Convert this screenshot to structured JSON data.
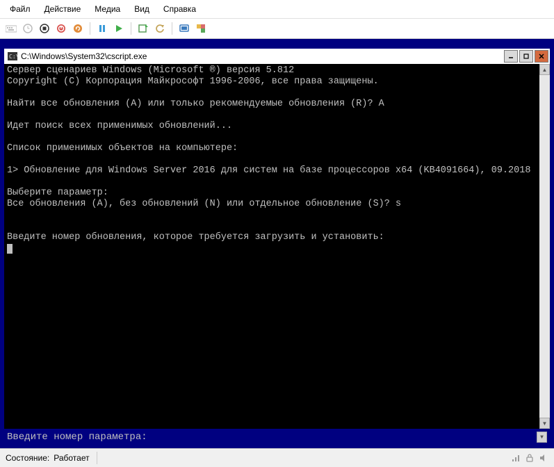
{
  "menu": {
    "items": [
      "Файл",
      "Действие",
      "Медиа",
      "Вид",
      "Справка"
    ]
  },
  "toolbar": {
    "icons": [
      "keyboard-icon",
      "clock-icon",
      "stop-icon",
      "shutdown-icon",
      "reset-icon",
      "sep",
      "pause-icon",
      "play-icon",
      "sep",
      "checkpoint-icon",
      "revert-icon",
      "sep",
      "enhanced-icon",
      "share-icon"
    ]
  },
  "console": {
    "title": "C:\\Windows\\System32\\cscript.exe",
    "lines": [
      "Сервер сценариев Windows (Microsoft ®) версия 5.812",
      "Copyright (C) Корпорация Майкрософт 1996-2006, все права защищены.",
      "",
      "Найти все обновления (A) или только рекомендуемые обновления (R)? A",
      "",
      "Идет поиск всех применимых обновлений...",
      "",
      "Список применимых объектов на компьютере:",
      "",
      "1> Обновление для Windows Server 2016 для систем на базе процессоров x64 (KB4091664), 09.2018",
      "",
      "Выберите параметр:",
      "Все обновления (A), без обновлений (N) или отдельное обновление (S)? s",
      "",
      "",
      "Введите номер обновления, которое требуется загрузить и установить:"
    ],
    "input_bar": "Введите номер параметра:"
  },
  "status": {
    "label": "Состояние:",
    "value": "Работает"
  }
}
